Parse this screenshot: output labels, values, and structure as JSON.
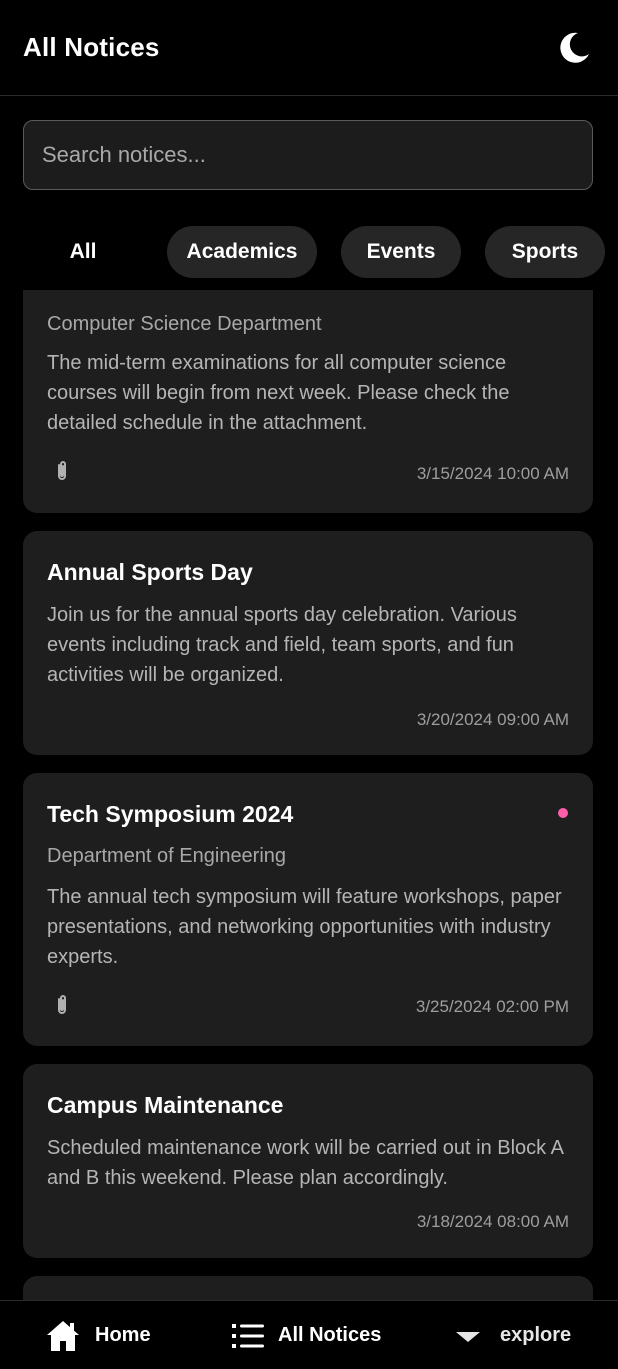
{
  "header": {
    "title": "All Notices",
    "theme_icon": "moon-icon"
  },
  "search": {
    "placeholder": "Search notices...",
    "value": ""
  },
  "filters": [
    {
      "label": "All",
      "active": true
    },
    {
      "label": "Academics",
      "active": false
    },
    {
      "label": "Events",
      "active": false
    },
    {
      "label": "Sports",
      "active": false
    }
  ],
  "notices": [
    {
      "title": "",
      "department": "Computer Science Department",
      "body": "The mid-term examinations for all computer science courses will begin from next week. Please check the detailed schedule in the attachment.",
      "timestamp": "3/15/2024 10:00 AM",
      "has_attachment": true,
      "unread": false
    },
    {
      "title": "Annual Sports Day",
      "department": "",
      "body": "Join us for the annual sports day celebration. Various events including track and field, team sports, and fun activities will be organized.",
      "timestamp": "3/20/2024 09:00 AM",
      "has_attachment": false,
      "unread": false
    },
    {
      "title": "Tech Symposium 2024",
      "department": "Department of Engineering",
      "body": "The annual tech symposium will feature workshops, paper presentations, and networking opportunities with industry experts.",
      "timestamp": "3/25/2024 02:00 PM",
      "has_attachment": true,
      "unread": true
    },
    {
      "title": "Campus Maintenance",
      "department": "",
      "body": "Scheduled maintenance work will be carried out in Block A and B this weekend. Please plan accordingly.",
      "timestamp": "3/18/2024 08:00 AM",
      "has_attachment": false,
      "unread": false
    }
  ],
  "bottom_nav": {
    "home": {
      "label": "Home",
      "icon": "home-icon"
    },
    "notices": {
      "label": "All Notices",
      "icon": "list-icon"
    },
    "explore": {
      "label": "explore",
      "icon": "caret-down-icon"
    }
  },
  "colors": {
    "background": "#000000",
    "card": "#1e1e1e",
    "chip": "#262626",
    "unread_dot": "#ff5fa8",
    "muted_text": "#a8a8a8"
  }
}
